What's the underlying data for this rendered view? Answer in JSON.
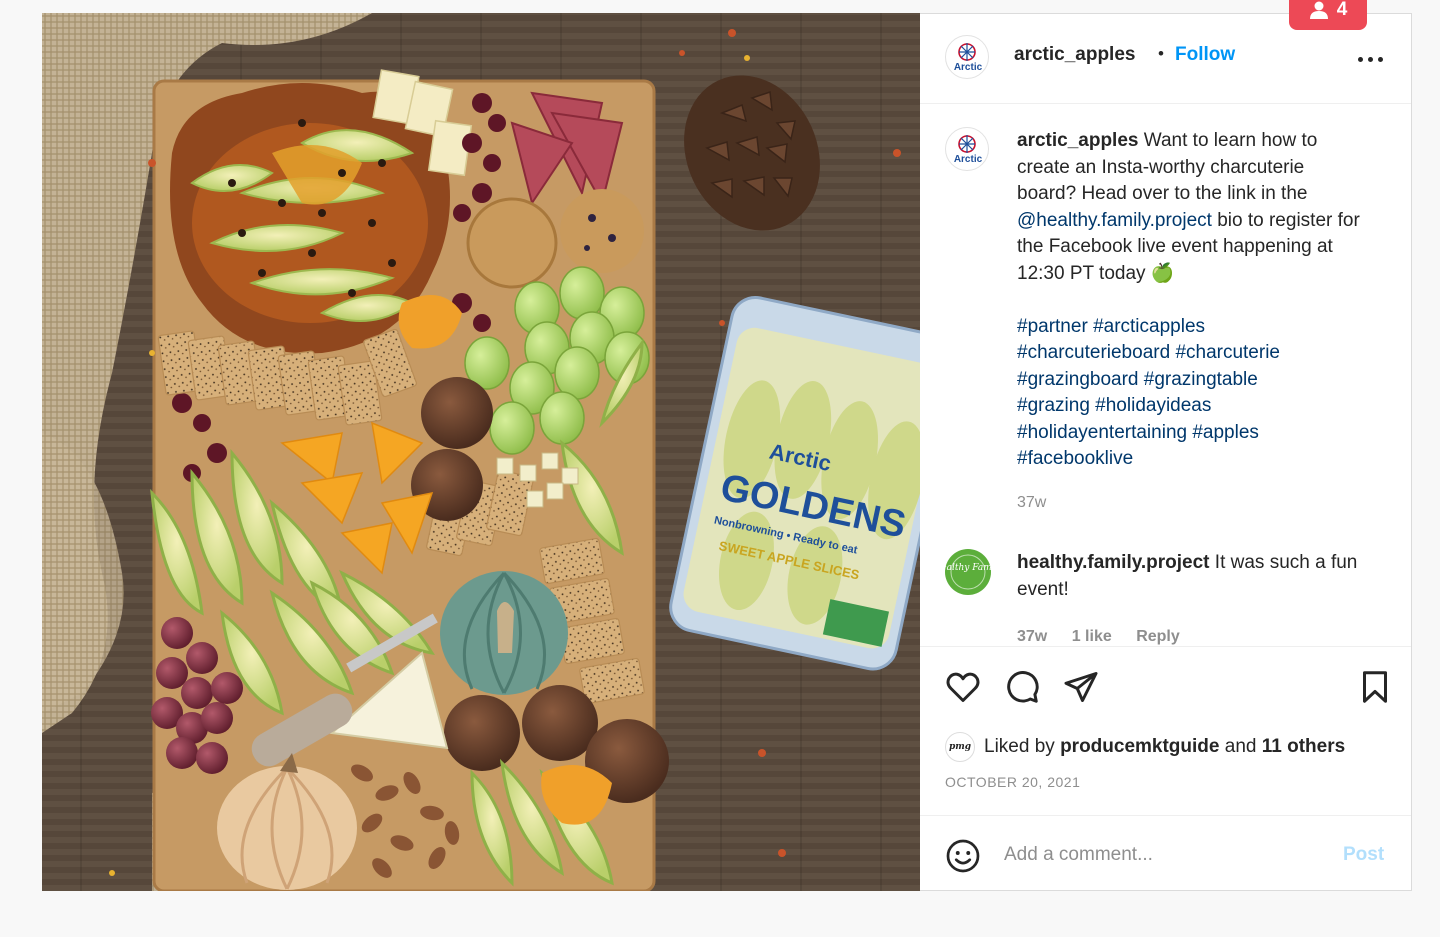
{
  "post": {
    "username": "arctic_apples",
    "separator": "•",
    "follow_label": "Follow",
    "more_icon": "more-horizontal-icon",
    "avatar_brand_text": "Arctic"
  },
  "caption": {
    "username": "arctic_apples",
    "text_before_link": "Want to learn how to create an Insta-worthy charcuterie board? Head over to the link in the",
    "link": "@healthy.family.project",
    "text_after_link": "bio to register for the Facebook live event happening at 12:30 PT today",
    "emoji": "🍏",
    "hashtags": [
      "#partner",
      "#arcticapples",
      "#charcuterieboard",
      "#charcuterie",
      "#grazingboard",
      "#grazingtable",
      "#grazing",
      "#holidayideas",
      "#holidayentertaining",
      "#apples",
      "#facebooklive"
    ],
    "time": "37w"
  },
  "comment": {
    "username": "healthy.family.project",
    "text": "It was such a fun event!",
    "avatar_text": "Healthy Family",
    "time": "37w",
    "likes": "1 like",
    "reply_label": "Reply"
  },
  "actions": {
    "like_icon": "heart-icon",
    "comment_icon": "comment-icon",
    "share_icon": "share-icon",
    "save_icon": "bookmark-icon"
  },
  "likes": {
    "prefix": "Liked by",
    "user": "producemktguide",
    "conjunction": "and",
    "others": "11 others",
    "avatar_text": "pmg"
  },
  "date": "OCTOBER 20, 2021",
  "add_comment": {
    "placeholder": "Add a comment...",
    "post_label": "Post",
    "emoji_icon": "smiley-icon"
  },
  "notification": {
    "count": "4",
    "icon": "user-icon"
  },
  "photo": {
    "package_text_1": "Arctic",
    "package_text_2": "GOLDENS",
    "package_text_3": "Nonbrowning • Ready to eat",
    "package_text_4": "SWEET APPLE SLICES",
    "colors": {
      "wood": "#5a4a3c",
      "board": "#c69a64",
      "accent": "#0095f6",
      "badge": "#ed4956"
    }
  }
}
